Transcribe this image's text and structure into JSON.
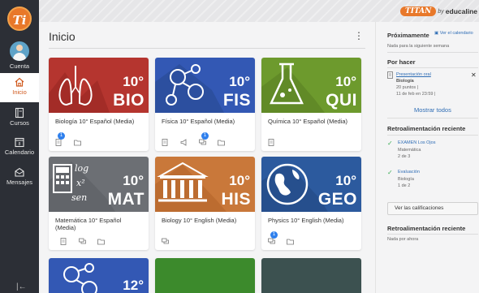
{
  "rail": {
    "items": [
      {
        "label": "Cuenta"
      },
      {
        "label": "Inicio"
      },
      {
        "label": "Cursos"
      },
      {
        "label": "Calendario"
      },
      {
        "label": "Mensajes"
      }
    ],
    "collapse_glyph": "|←"
  },
  "brand": {
    "name": "TITAN",
    "by": "by",
    "company": "educaline"
  },
  "main": {
    "title": "Inicio",
    "menu_glyph": "⋮",
    "cards": [
      {
        "grade": "10°",
        "code": "BIO",
        "name": "Biología 10° Español (Media)",
        "color": "#b5352f",
        "badges": [
          1,
          null
        ]
      },
      {
        "grade": "10°",
        "code": "FIS",
        "name": "Física 10° Español (Media)",
        "color": "#3358b4",
        "badges": [
          null,
          null,
          1,
          null
        ]
      },
      {
        "grade": "10°",
        "code": "QUI",
        "name": "Química 10° Español (Media)",
        "color": "#6d9a2d",
        "badges": [
          null
        ]
      },
      {
        "grade": "10°",
        "code": "MAT",
        "name": "Matemática 10° Español (Media)",
        "color": "#6c6f74",
        "badges": [
          null,
          null,
          null
        ]
      },
      {
        "grade": "10°",
        "code": "HIS",
        "name": "Biology 10° English (Media)",
        "color": "#c9783a",
        "badges": [
          null
        ]
      },
      {
        "grade": "10°",
        "code": "GEO",
        "name": "Physics 10° English (Media)",
        "color": "#2c5a9e",
        "badges": [
          1,
          null
        ]
      },
      {
        "grade": "12°",
        "code": "",
        "name": "",
        "color": "#3358b4",
        "badges": []
      },
      {
        "grade": "",
        "code": "",
        "name": "",
        "color": "#3c8a2c",
        "badges": []
      },
      {
        "grade": "",
        "code": "",
        "name": "",
        "color": "#3c5150",
        "badges": []
      }
    ]
  },
  "side": {
    "upcoming_title": "Próximamente",
    "calendar_link": "Ver el calendario",
    "upcoming_empty": "Nada para la siguiente semana",
    "todo_title": "Por hacer",
    "todo": {
      "title": "Presentación oral",
      "course": "Biología",
      "points": "20 puntos  |",
      "due": "11 de feb en 23:59  |"
    },
    "show_all": "Mostrar todos",
    "feedback_title": "Retroalimentación reciente",
    "feedback": [
      {
        "title": "EXAMEN Los Ojos",
        "course": "Matemática",
        "score": "2 de 3"
      },
      {
        "title": "Evaluación",
        "course": "Biología",
        "score": "1 de 2"
      }
    ],
    "grades_button": "Ver las calificaciones",
    "feedback2_title": "Retroalimentación reciente",
    "feedback2_empty": "Nada por ahora",
    "colors": {
      "link": "#2f6db5",
      "check": "#3fae5a",
      "accent": "#d05a1f"
    }
  }
}
